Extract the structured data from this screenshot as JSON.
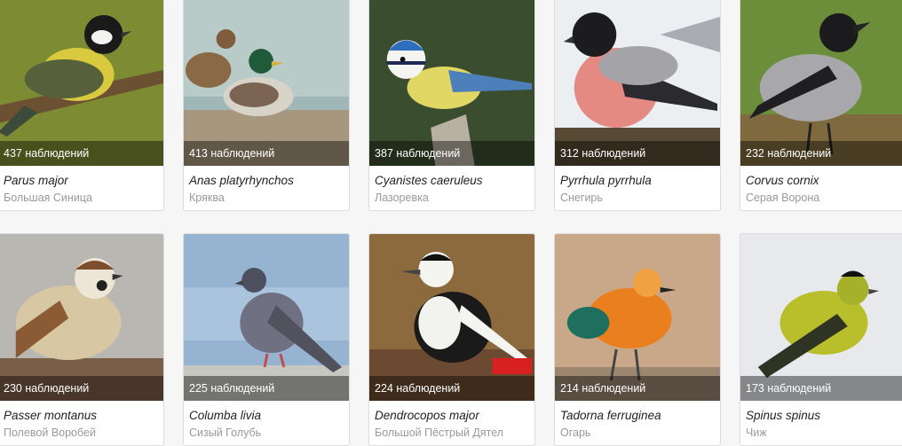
{
  "cards": [
    {
      "count": "437 наблюдений",
      "scientific": "Parus major",
      "common": "Большая Синица",
      "icon": "great-tit-photo"
    },
    {
      "count": "413 наблюдений",
      "scientific": "Anas platyrhynchos",
      "common": "Кряква",
      "icon": "mallard-photo"
    },
    {
      "count": "387 наблюдений",
      "scientific": "Cyanistes caeruleus",
      "common": "Лазоревка",
      "icon": "blue-tit-photo"
    },
    {
      "count": "312 наблюдений",
      "scientific": "Pyrrhula pyrrhula",
      "common": "Снегирь",
      "icon": "bullfinch-photo"
    },
    {
      "count": "232 наблюдений",
      "scientific": "Corvus cornix",
      "common": "Серая Ворона",
      "icon": "hooded-crow-photo"
    },
    {
      "count": "230 наблюдений",
      "scientific": "Passer montanus",
      "common": "Полевой Воробей",
      "icon": "tree-sparrow-photo"
    },
    {
      "count": "225 наблюдений",
      "scientific": "Columba livia",
      "common": "Сизый Голубь",
      "icon": "rock-dove-photo"
    },
    {
      "count": "224 наблюдений",
      "scientific": "Dendrocopos major",
      "common": "Большой Пёстрый Дятел",
      "icon": "woodpecker-photo"
    },
    {
      "count": "214 наблюдений",
      "scientific": "Tadorna ferruginea",
      "common": "Огарь",
      "icon": "ruddy-shelduck-photo"
    },
    {
      "count": "173 наблюдений",
      "scientific": "Spinus spinus",
      "common": "Чиж",
      "icon": "siskin-photo"
    }
  ]
}
